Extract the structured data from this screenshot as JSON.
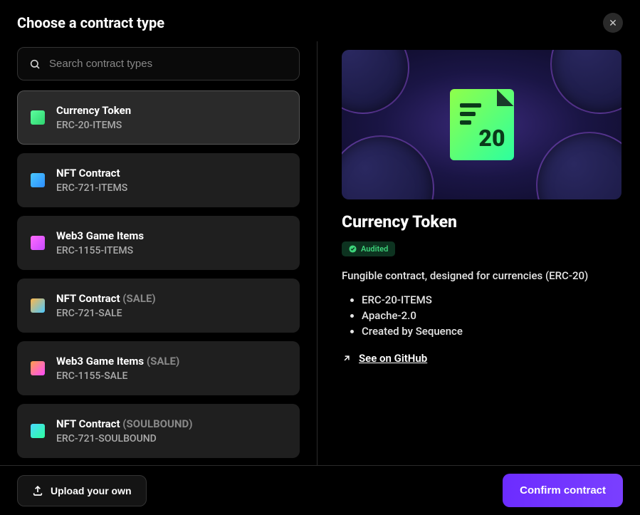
{
  "header": {
    "title": "Choose a contract type"
  },
  "search": {
    "placeholder": "Search contract types"
  },
  "contracts": [
    {
      "title": "Currency Token",
      "suffix": "",
      "sub": "ERC-20-ITEMS",
      "icon": "ic-20",
      "selected": true
    },
    {
      "title": "NFT Contract",
      "suffix": "",
      "sub": "ERC-721-ITEMS",
      "icon": "ic-721",
      "selected": false
    },
    {
      "title": "Web3 Game Items",
      "suffix": "",
      "sub": "ERC-1155-ITEMS",
      "icon": "ic-1155",
      "selected": false
    },
    {
      "title": "NFT Contract",
      "suffix": "(SALE)",
      "sub": "ERC-721-SALE",
      "icon": "ic-721-sale",
      "selected": false
    },
    {
      "title": "Web3 Game Items",
      "suffix": "(SALE)",
      "sub": "ERC-1155-SALE",
      "icon": "ic-1155-sale",
      "selected": false
    },
    {
      "title": "NFT Contract",
      "suffix": "(SOULBOUND)",
      "sub": "ERC-721-SOULBOUND",
      "icon": "ic-721-sb",
      "selected": false
    }
  ],
  "detail": {
    "hero_number": "20",
    "title": "Currency Token",
    "audited_label": "Audited",
    "description": "Fungible contract, designed for currencies (ERC-20)",
    "bullets": [
      "ERC-20-ITEMS",
      "Apache-2.0",
      "Created by Sequence"
    ],
    "github_label": "See on GitHub"
  },
  "footer": {
    "upload_label": "Upload your own",
    "confirm_label": "Confirm contract"
  }
}
